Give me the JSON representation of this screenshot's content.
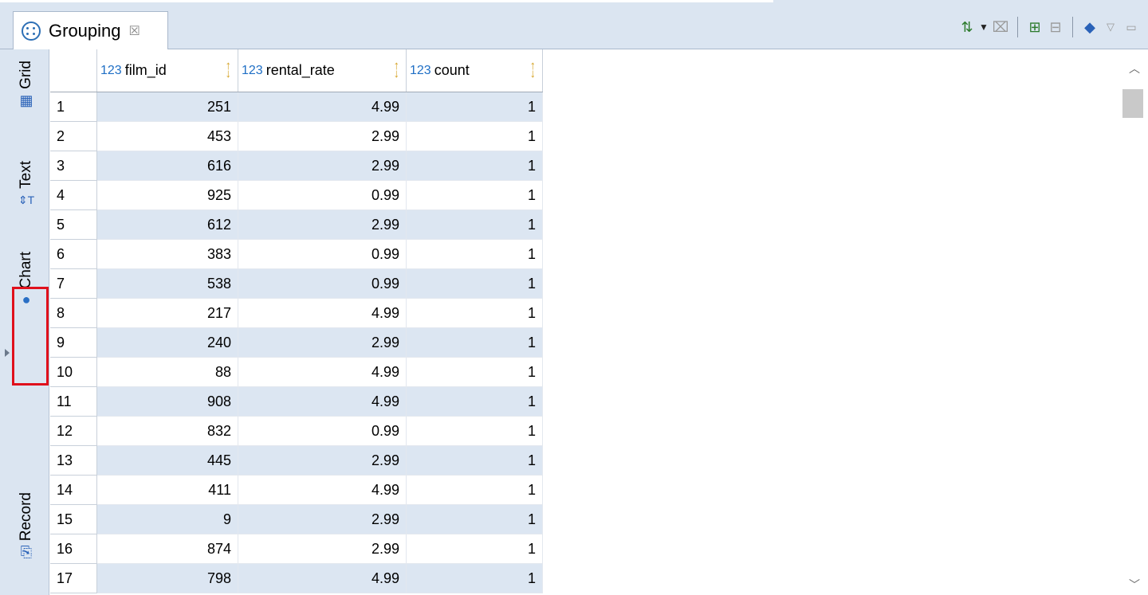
{
  "tab": {
    "label": "Grouping",
    "close_glyph": "☒"
  },
  "toolbar": {
    "icons": [
      "sort-settings-icon",
      "dropdown-arrow-icon",
      "filter-clear-icon",
      "add-column-icon",
      "remove-column-icon",
      "eraser-icon",
      "view-menu-icon",
      "minimize-icon"
    ]
  },
  "rail": {
    "grid": "Grid",
    "text": "Text",
    "chart": "Chart",
    "record": "Record"
  },
  "columns": [
    {
      "type": "123",
      "name": "film_id"
    },
    {
      "type": "123",
      "name": "rental_rate"
    },
    {
      "type": "123",
      "name": "count"
    }
  ],
  "rows": [
    {
      "n": "1",
      "film_id": "251",
      "rental_rate": "4.99",
      "count": "1"
    },
    {
      "n": "2",
      "film_id": "453",
      "rental_rate": "2.99",
      "count": "1"
    },
    {
      "n": "3",
      "film_id": "616",
      "rental_rate": "2.99",
      "count": "1"
    },
    {
      "n": "4",
      "film_id": "925",
      "rental_rate": "0.99",
      "count": "1"
    },
    {
      "n": "5",
      "film_id": "612",
      "rental_rate": "2.99",
      "count": "1"
    },
    {
      "n": "6",
      "film_id": "383",
      "rental_rate": "0.99",
      "count": "1"
    },
    {
      "n": "7",
      "film_id": "538",
      "rental_rate": "0.99",
      "count": "1"
    },
    {
      "n": "8",
      "film_id": "217",
      "rental_rate": "4.99",
      "count": "1"
    },
    {
      "n": "9",
      "film_id": "240",
      "rental_rate": "2.99",
      "count": "1"
    },
    {
      "n": "10",
      "film_id": "88",
      "rental_rate": "4.99",
      "count": "1"
    },
    {
      "n": "11",
      "film_id": "908",
      "rental_rate": "4.99",
      "count": "1"
    },
    {
      "n": "12",
      "film_id": "832",
      "rental_rate": "0.99",
      "count": "1"
    },
    {
      "n": "13",
      "film_id": "445",
      "rental_rate": "2.99",
      "count": "1"
    },
    {
      "n": "14",
      "film_id": "411",
      "rental_rate": "4.99",
      "count": "1"
    },
    {
      "n": "15",
      "film_id": "9",
      "rental_rate": "2.99",
      "count": "1"
    },
    {
      "n": "16",
      "film_id": "874",
      "rental_rate": "2.99",
      "count": "1"
    },
    {
      "n": "17",
      "film_id": "798",
      "rental_rate": "4.99",
      "count": "1"
    }
  ],
  "colors": {
    "accent": "#1f6fc5",
    "highlight_border": "#e0101c",
    "alt_row": "#dce6f2"
  }
}
